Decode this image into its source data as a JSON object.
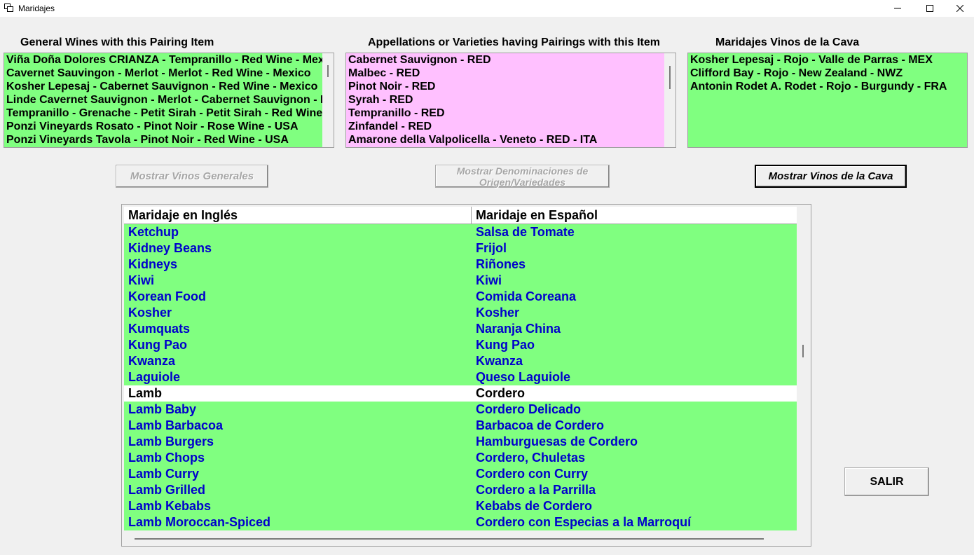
{
  "window": {
    "title": "Maridajes"
  },
  "captions": {
    "general": "General Wines  with this Pairing Item",
    "appellations": "Appellations or Varieties having Pairings  with this Item",
    "cava": "Maridajes Vinos de la Cava"
  },
  "general_wines": [
    "Viña Doña Dolores  CRIANZA -  Tempranillo - Red Wine - Mexico",
    "Cavernet Sauvingon - Merlot -  Merlot - Red Wine - Mexico",
    "Kosher Lepesaj -  Cabernet Sauvignon - Red Wine - Mexico",
    "Linde Cavernet Sauvignon - Merlot -  Cabernet Sauvignon - Red Wine",
    "Tempranillo - Grenache - Petit Sirah -  Petit Sirah - Red Wine - Mexico",
    "Ponzi Vineyards Rosato -  Pinot Noir - Rose Wine - USA",
    "Ponzi Vineyards Tavola -  Pinot Noir - Red Wine - USA"
  ],
  "appellations": [
    "Cabernet Sauvignon -  RED",
    "Malbec -  RED",
    "Pinot Noir -  RED",
    "Syrah -  RED",
    "Tempranillo -  RED",
    "Zinfandel -  RED",
    "Amarone della Valpolicella -  Veneto - RED - ITA"
  ],
  "cava_wines": [
    "Kosher Lepesaj - Rojo - Valle de Parras - MEX",
    "Clifford Bay - Rojo - New Zealand - NWZ",
    "Antonin Rodet A. Rodet - Rojo - Burgundy - FRA"
  ],
  "buttons": {
    "general": "Mostrar Vinos Generales",
    "appellations": "Mostrar Denominaciones de Origen/Variedades",
    "cava": "Mostrar Vinos de la Cava",
    "exit": "SALIR"
  },
  "grid": {
    "headers": [
      "Maridaje en Inglés",
      "Maridaje en Español"
    ],
    "selected_index": 9,
    "rows": [
      [
        "Ketchup",
        "Salsa de Tomate"
      ],
      [
        "Kidney Beans",
        "Frijol"
      ],
      [
        "Kidneys",
        "Riñones"
      ],
      [
        "Kiwi",
        "Kiwi"
      ],
      [
        "Korean Food",
        "Comida Coreana"
      ],
      [
        "Kosher",
        "Kosher"
      ],
      [
        "Kumquats",
        "Naranja China"
      ],
      [
        "Kung Pao",
        "Kung Pao"
      ],
      [
        "Kwanza",
        "Kwanza"
      ],
      [
        "Laguiole",
        "Queso Laguiole"
      ],
      [
        "Lamb",
        "Cordero"
      ],
      [
        "Lamb Baby",
        "Cordero Delicado"
      ],
      [
        "Lamb Barbacoa",
        "Barbacoa de Cordero"
      ],
      [
        "Lamb Burgers",
        "Hamburguesas de Cordero"
      ],
      [
        "Lamb Chops",
        "Cordero, Chuletas"
      ],
      [
        "Lamb Curry",
        "Cordero con Curry"
      ],
      [
        "Lamb Grilled",
        "Cordero a la Parrilla"
      ],
      [
        "Lamb Kebabs",
        "Kebabs de Cordero"
      ],
      [
        "Lamb Moroccan-Spiced",
        "Cordero con Especias a la Marroquí"
      ]
    ]
  },
  "colors": {
    "green_list": "#80ff80",
    "pink_list": "#ffc0ff",
    "grid_text": "#0000cc"
  }
}
